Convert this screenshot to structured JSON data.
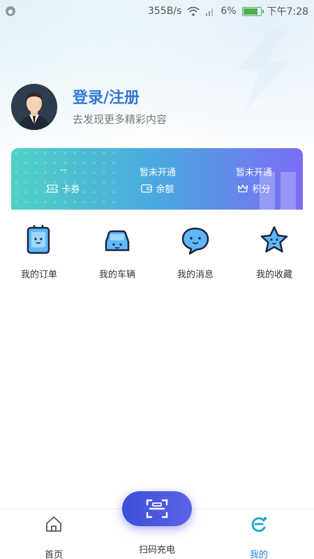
{
  "status_bar": {
    "speed": "355B/s",
    "battery": "6%",
    "time": "下午7:28"
  },
  "profile": {
    "title": "登录/注册",
    "subtitle": "去发现更多精彩内容"
  },
  "wallet": {
    "items": [
      {
        "value": "--",
        "label": "卡券",
        "icon": "ticket-icon"
      },
      {
        "value": "暂未开通",
        "label": "余额",
        "icon": "wallet-icon"
      },
      {
        "value": "暂未开通",
        "label": "积分",
        "icon": "crown-icon"
      }
    ]
  },
  "quick_menu": [
    {
      "label": "我的订单",
      "icon": "order-icon"
    },
    {
      "label": "我的车辆",
      "icon": "car-icon"
    },
    {
      "label": "我的消息",
      "icon": "message-icon"
    },
    {
      "label": "我的收藏",
      "icon": "star-icon"
    }
  ],
  "bottom_nav": {
    "home": "首页",
    "scan": "扫码充电",
    "mine": "我的"
  },
  "colors": {
    "accent": "#3478d4",
    "active_tab": "#2d86d6",
    "scan_button": "#4a57e0"
  }
}
